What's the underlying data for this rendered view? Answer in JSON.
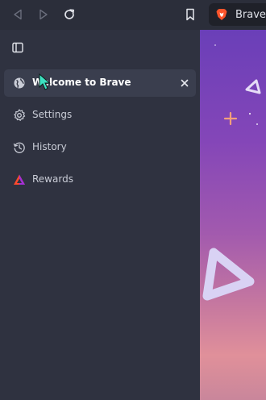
{
  "toolbar": {
    "brave_label": "Brave"
  },
  "sidebar": {
    "items": [
      {
        "label": "Welcome to Brave",
        "icon": "globe-icon",
        "active": true
      },
      {
        "label": "Settings",
        "icon": "gear-icon"
      },
      {
        "label": "History",
        "icon": "history-icon"
      },
      {
        "label": "Rewards",
        "icon": "rewards-icon"
      }
    ]
  },
  "colors": {
    "toolbar_bg": "#2b2e3a",
    "sidebar_bg": "#2f3240",
    "active_item_bg": "#3a3e4e",
    "brave_orange": "#fb542b",
    "content_top": "#6a3fb8",
    "content_bottom": "#e0909a"
  }
}
